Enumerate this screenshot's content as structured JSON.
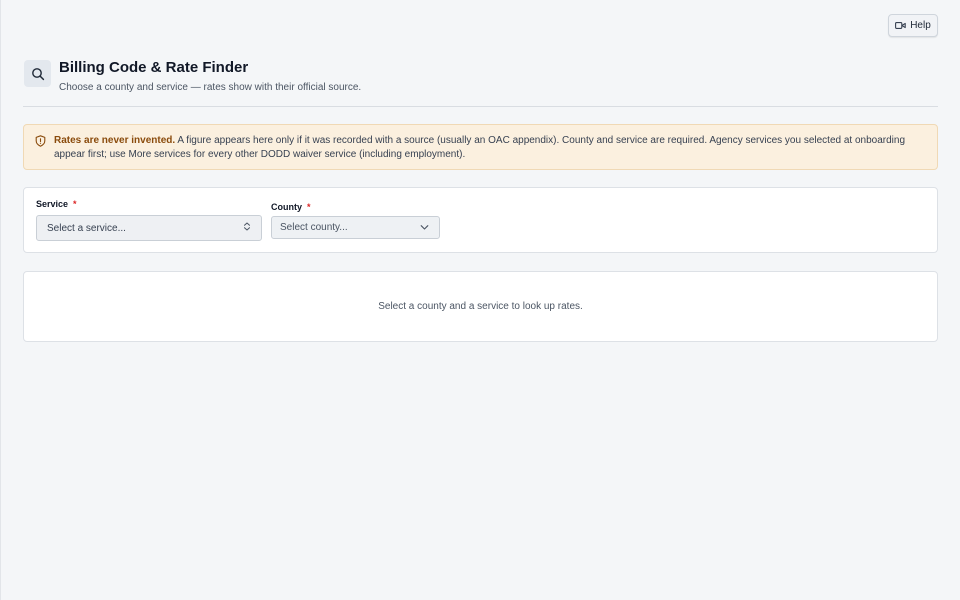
{
  "help": {
    "label": "Help",
    "icon": "video-icon"
  },
  "header": {
    "icon": "search-icon",
    "title": "Billing Code & Rate Finder",
    "subtitle": "Choose a county and service — rates show with their official source."
  },
  "notice": {
    "icon": "shield-icon",
    "bold": "Rates are never invented.",
    "text": " A figure appears here only if it was recorded with a source (usually an OAC appendix). County and service are required. Agency services you selected at onboarding appear first; use More services for every other DODD waiver service (including employment)."
  },
  "form": {
    "service": {
      "label": "Service",
      "required_mark": "*",
      "placeholder": "Select a service..."
    },
    "county": {
      "label": "County",
      "required_mark": "*",
      "placeholder": "Select county..."
    }
  },
  "results": {
    "empty_message": "Select a county and a service to look up rates."
  },
  "colors": {
    "accent": "#8a4b0c",
    "required": "#dc2626",
    "notice_bg": "#fbf0df"
  }
}
